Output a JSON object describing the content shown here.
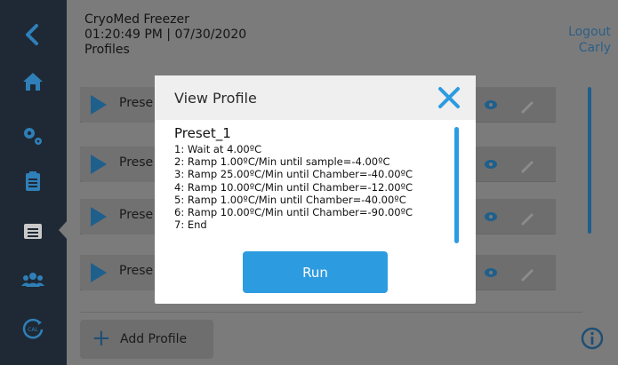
{
  "header": {
    "device_name": "CryoMed Freezer",
    "datetime": "01:20:49 PM | 07/30/2020",
    "section": "Profiles"
  },
  "account": {
    "logout_label": "Logout",
    "user": "Carly"
  },
  "sidebar": {
    "items": [
      {
        "icon": "back-arrow-icon"
      },
      {
        "icon": "home-icon"
      },
      {
        "icon": "settings-gears-icon"
      },
      {
        "icon": "clipboard-icon"
      },
      {
        "icon": "profiles-icon",
        "active": true
      },
      {
        "icon": "users-icon"
      },
      {
        "icon": "calibration-icon",
        "label": "CAL"
      }
    ]
  },
  "profile_rows": [
    {
      "name": "Prese"
    },
    {
      "name": "Prese"
    },
    {
      "name": "Prese"
    },
    {
      "name": "Prese"
    }
  ],
  "add_profile_label": "Add Profile",
  "modal": {
    "title": "View Profile",
    "preset_name": "Preset_1",
    "steps": [
      "1: Wait at 4.00ºC",
      "2: Ramp 1.00ºC/Min until sample=-4.00ºC",
      "3: Ramp 25.00ºC/Min until Chamber=-40.00ºC",
      "4: Ramp 10.00ºC/Min until Chamber=-12.00ºC",
      "5: Ramp 1.00ºC/Min until Chamber=-40.00ºC",
      "6: Ramp 10.00ºC/Min until Chamber=-90.00ºC",
      "7: End"
    ],
    "run_label": "Run"
  },
  "colors": {
    "accent": "#2d9be0",
    "sidebar_bg": "#1e2935",
    "overlay_bg": "#7b7b7b",
    "dark_accent": "#1f5f8c"
  }
}
